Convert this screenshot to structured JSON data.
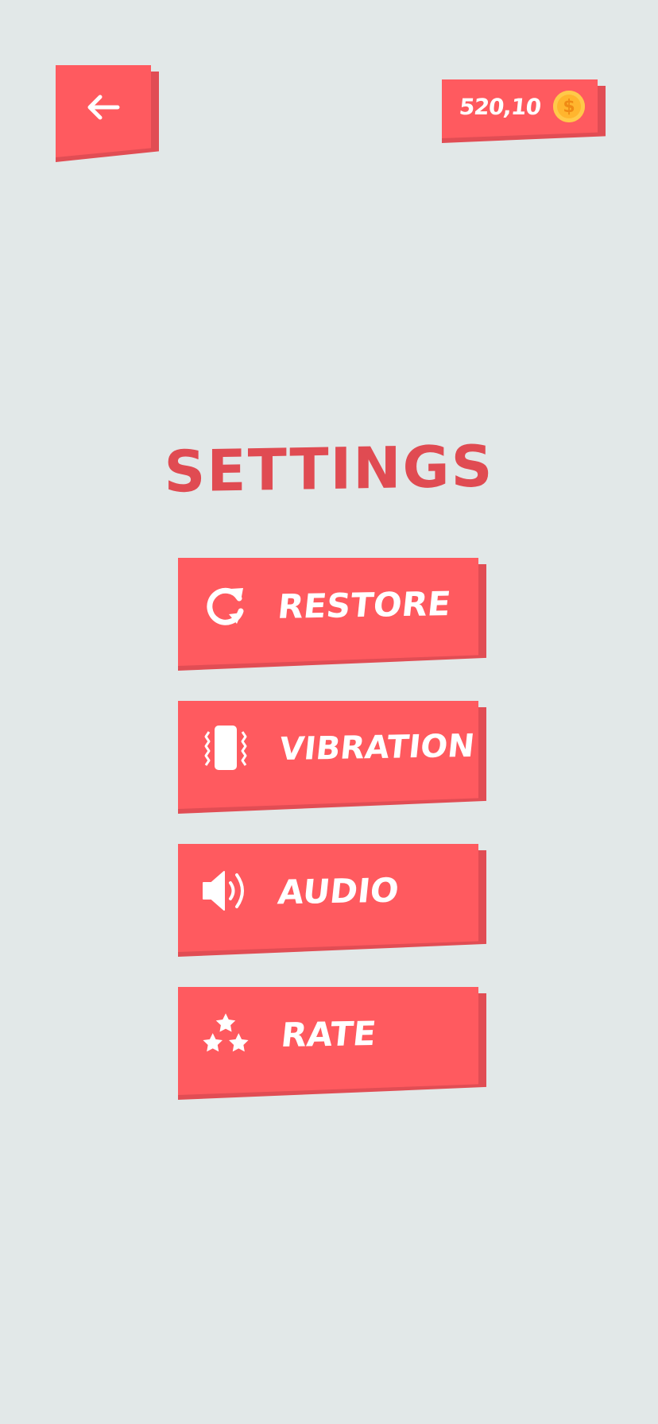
{
  "header": {
    "back_icon": "arrow-left-icon",
    "coins": "520,10",
    "coin_icon": "dollar-coin-icon",
    "coin_symbol": "$"
  },
  "title": "SETTINGS",
  "menu": {
    "restore": {
      "label": "RESTORE",
      "icon": "refresh-icon"
    },
    "vibration": {
      "label": "VIBRATION",
      "icon": "vibration-icon"
    },
    "audio": {
      "label": "AUDIO",
      "icon": "speaker-icon"
    },
    "rate": {
      "label": "RATE",
      "icon": "stars-icon"
    }
  },
  "colors": {
    "background": "#e2e8e8",
    "button_face": "#ff5a5f",
    "button_shadow": "#e14d54",
    "title": "#e04b52",
    "coin": "#ffb52e"
  }
}
